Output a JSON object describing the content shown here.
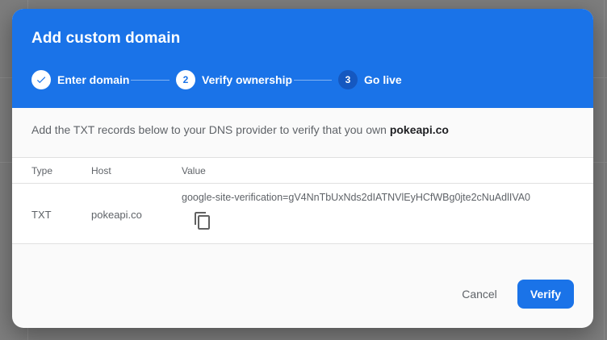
{
  "dialog": {
    "title": "Add custom domain",
    "steps": [
      {
        "number": "",
        "label": "Enter domain",
        "state": "complete"
      },
      {
        "number": "2",
        "label": "Verify ownership",
        "state": "active"
      },
      {
        "number": "3",
        "label": "Go live",
        "state": "upcoming"
      }
    ],
    "intro_text": "Add the TXT records below to your DNS provider to verify that you own ",
    "domain": "pokeapi.co",
    "table": {
      "headers": [
        "Type",
        "Host",
        "Value"
      ],
      "rows": [
        {
          "type": "TXT",
          "host": "pokeapi.co",
          "value": "google-site-verification=gV4NnTbUxNds2dIATNVlEyHCfWBg0jte2cNuAdlIVA0"
        }
      ]
    },
    "buttons": {
      "cancel": "Cancel",
      "verify": "Verify"
    }
  },
  "icons": {
    "step_complete": "check-icon",
    "copy": "copy-icon"
  },
  "colors": {
    "primary": "#1a73e8",
    "step_upcoming": "#1558c0"
  }
}
